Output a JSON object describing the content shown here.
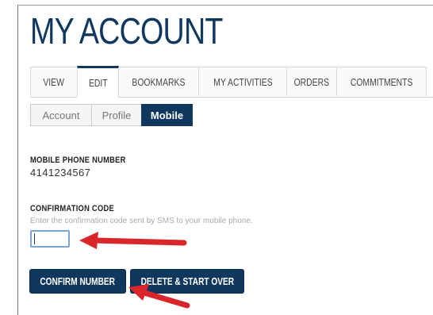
{
  "page": {
    "title": "MY ACCOUNT"
  },
  "tabs": [
    {
      "label": "VIEW",
      "active": false
    },
    {
      "label": "EDIT",
      "active": true
    },
    {
      "label": "BOOKMARKS",
      "active": false
    },
    {
      "label": "MY ACTIVITIES",
      "active": false
    },
    {
      "label": "ORDERS",
      "active": false
    },
    {
      "label": "COMMITMENTS",
      "active": false
    }
  ],
  "subtabs": [
    {
      "label": "Account",
      "active": false
    },
    {
      "label": "Profile",
      "active": false
    },
    {
      "label": "Mobile",
      "active": true
    }
  ],
  "mobile": {
    "phone_label": "MOBILE PHONE NUMBER",
    "phone_value": "4141234567",
    "code_label": "CONFIRMATION CODE",
    "code_help": "Enter the confirmation code sent by SMS to your mobile phone.",
    "code_value": ""
  },
  "buttons": {
    "confirm": "CONFIRM NUMBER",
    "delete": "DELETE & START OVER"
  },
  "colors": {
    "brand": "#10385f",
    "annotation_arrow": "#d8262b",
    "input_border": "#7aa6d6"
  }
}
